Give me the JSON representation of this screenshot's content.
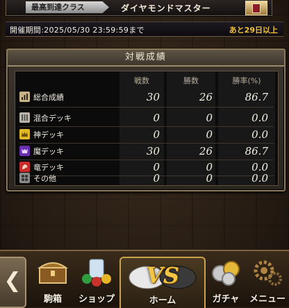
{
  "rank": {
    "label": "最高到達クラス",
    "value": "ダイヤモンドマスター"
  },
  "period": {
    "text": "開催期間:2025/05/30 23:59:59まで",
    "remaining": "あと29日以上"
  },
  "stats": {
    "title": "対戦成績",
    "headers": {
      "battles": "戦数",
      "wins": "勝数",
      "rate": "勝率(%)"
    },
    "rows": [
      {
        "label": "総合成績",
        "battles": "30",
        "wins": "26",
        "rate": "86.7",
        "icon": "overall-icon",
        "color": "#c9b48a"
      },
      {
        "label": "混合デッキ",
        "battles": "0",
        "wins": "0",
        "rate": "0.0",
        "icon": "mixed-deck-icon",
        "color": "#bdb7ab"
      },
      {
        "label": "神デッキ",
        "battles": "0",
        "wins": "0",
        "rate": "0.0",
        "icon": "god-deck-icon",
        "color": "#e0b826"
      },
      {
        "label": "魔デッキ",
        "battles": "30",
        "wins": "26",
        "rate": "86.7",
        "icon": "demon-deck-icon",
        "color": "#6a2fb0"
      },
      {
        "label": "竜デッキ",
        "battles": "0",
        "wins": "0",
        "rate": "0.0",
        "icon": "dragon-deck-icon",
        "color": "#c92a2a"
      },
      {
        "label": "その他",
        "battles": "0",
        "wins": "0",
        "rate": "0.0",
        "icon": "other-icon",
        "color": "#8a8a8a"
      }
    ]
  },
  "nav": {
    "box": "駒箱",
    "shop": "ショップ",
    "home": "ホーム",
    "home_emblem": "VS",
    "gacha": "ガチャ",
    "menu": "メニュー"
  }
}
